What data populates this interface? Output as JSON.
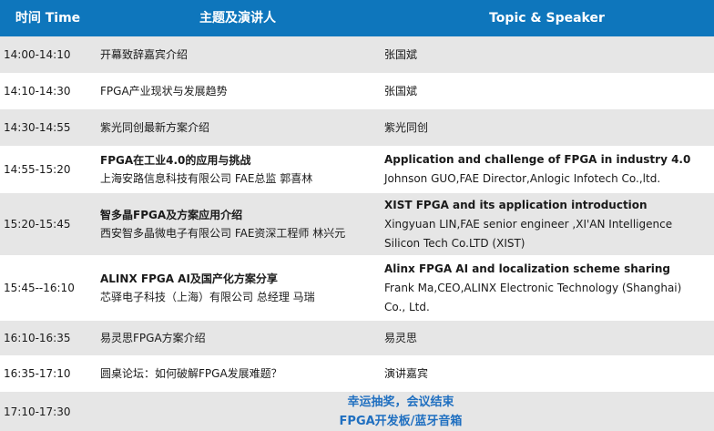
{
  "header": {
    "time": "时间 Time",
    "topic_zh": "主题及演讲人",
    "topic_en": "Topic & Speaker"
  },
  "rows": [
    {
      "time": "14:00-14:10",
      "zh": [
        "开幕致辞嘉宾介绍"
      ],
      "en": [
        "张国斌"
      ]
    },
    {
      "time": "14:10-14:30",
      "zh": [
        "FPGA产业现状与发展趋势"
      ],
      "en": [
        "张国斌"
      ]
    },
    {
      "time": "14:30-14:55",
      "zh": [
        "紫光同创最新方案介绍"
      ],
      "en": [
        "紫光同创"
      ]
    },
    {
      "time": "14:55-15:20",
      "zh": [
        "FPGA在工业4.0的应用与挑战",
        "上海安路信息科技有限公司  FAE总监  郭喜林"
      ],
      "en": [
        "Application and challenge of FPGA in industry 4.0",
        "Johnson GUO,FAE Director,Anlogic Infotech Co.,ltd."
      ]
    },
    {
      "time": "15:20-15:45",
      "zh": [
        "智多晶FPGA及方案应用介绍",
        "西安智多晶微电子有限公司 FAE资深工程师  林兴元"
      ],
      "en": [
        "XIST FPGA and its application introduction",
        "Xingyuan LIN,FAE senior engineer  ,XI'AN Intelligence",
        "Silicon Tech Co.LTD  (XIST)"
      ]
    },
    {
      "time": "15:45--16:10",
      "zh": [
        "ALINX FPGA AI及国产化方案分享",
        "芯驿电子科技（上海）有限公司  总经理  马瑞"
      ],
      "en": [
        "Alinx FPGA AI and localization scheme sharing",
        "Frank Ma,CEO,ALINX Electronic Technology (Shanghai)",
        "Co., Ltd."
      ]
    },
    {
      "time": "16:10-16:35",
      "zh": [
        "易灵思FPGA方案介绍"
      ],
      "en": [
        "易灵思"
      ]
    },
    {
      "time": "16:35-17:10",
      "zh": [
        "圆桌论坛：如何破解FPGA发展难题？"
      ],
      "en": [
        "演讲嘉宾"
      ]
    }
  ],
  "closing": {
    "time": "17:10-17:30",
    "line1": "幸运抽奖，会议结束",
    "line2": "FPGA开发板/蓝牙音箱"
  },
  "colors": {
    "header_bg": "#0e76bc",
    "row_alt_bg": "#e6e6e6",
    "closing_text": "#1f6fc0"
  }
}
